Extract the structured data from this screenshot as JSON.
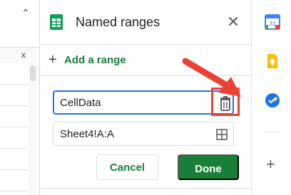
{
  "sheet": {
    "collapse_icon": "chevron-up-icon",
    "close_glyph": "x"
  },
  "panel": {
    "title": "Named ranges",
    "icon": "sheets-icon",
    "add_range_label": "Add a range",
    "name_value": "CellData",
    "range_value": "Sheet4!A:A",
    "cancel_label": "Cancel",
    "done_label": "Done"
  },
  "colors": {
    "accent_green": "#188038",
    "focus_blue": "#1a73e8",
    "highlight_red": "#ea4335"
  },
  "rail": {
    "items": [
      "calendar-icon",
      "keep-icon",
      "tasks-icon",
      "add-icon"
    ],
    "calendar_day": "31"
  }
}
